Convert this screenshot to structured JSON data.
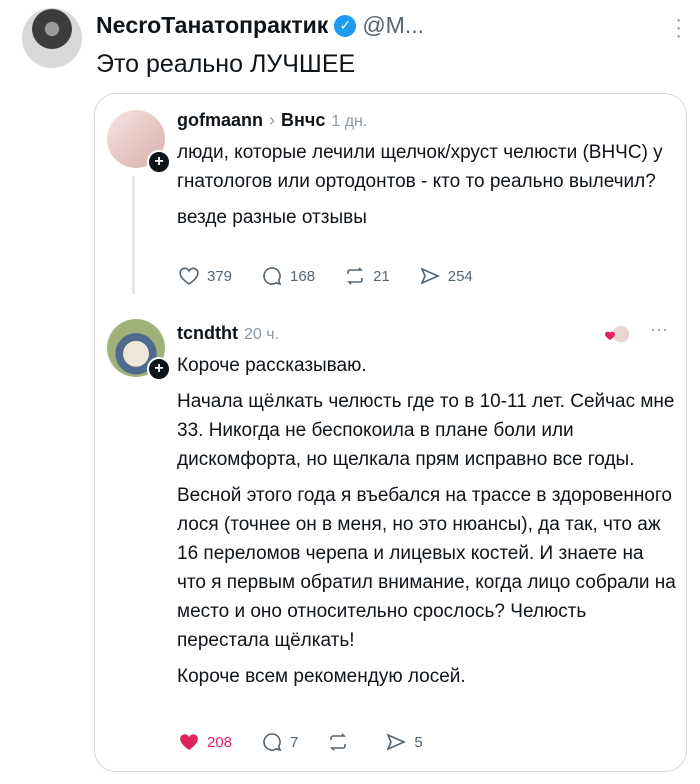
{
  "tweet": {
    "author_name": "NecroТанатопрактик",
    "handle": "@M...",
    "text": "Это реально ЛУЧШЕЕ",
    "more_icon": "more-vertical-icon",
    "verified_icon": "verified-badge-icon"
  },
  "quoted": {
    "posts": [
      {
        "username": "gofmaann",
        "topic": "Внчс",
        "time": "1 дн.",
        "paragraphs": [
          "люди, которые лечили щелчок/хруст челюсти (ВНЧС) у гнатологов или ортодонтов - кто то реально вылечил?",
          "везде разные отзывы"
        ],
        "likes": "379",
        "replies": "168",
        "reposts": "21",
        "shares": "254"
      },
      {
        "username": "tcndtht",
        "time": "20 ч.",
        "paragraphs": [
          "Короче рассказываю.",
          "Начала щёлкать челюсть где то в 10-11 лет. Сейчас мне 33. Никогда не беспокоила в плане боли или дискомфорта, но щелкала прям исправно все годы.",
          "Весной этого года я въебался на трассе в здоровенного лося (точнее он в меня, но это нюансы), да так, что аж 16 переломов черепа и лицевых костей. И знаете на что я первым обратил внимание, когда лицо собрали на место и оно относительно срослось? Челюсть перестала щёлкать!",
          "Короче всем рекомендую лосей."
        ],
        "likes": "208",
        "replies": "7",
        "reposts": "",
        "shares": "5"
      }
    ],
    "colors": {
      "like_active": "#e0245e",
      "muted": "#536471"
    }
  }
}
